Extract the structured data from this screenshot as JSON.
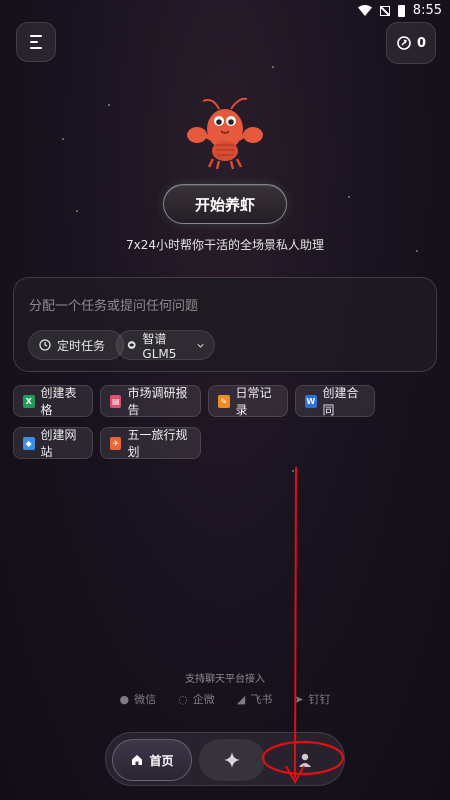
{
  "status_bar": {
    "time": "8:55"
  },
  "header": {
    "credits": "0"
  },
  "hero": {
    "start_button": "开始养虾",
    "tagline": "7x24小时帮你干活的全场景私人助理"
  },
  "composer": {
    "placeholder": "分配一个任务或提问任何问题",
    "timer_chip": "定时任务",
    "model_chip": "智谱 GLM5"
  },
  "quick_actions": [
    {
      "label": "创建表格",
      "icon": "spreadsheet-icon",
      "color": "#1f9d57"
    },
    {
      "label": "市场调研报告",
      "icon": "report-icon",
      "color": "#e04f6b"
    },
    {
      "label": "日常记录",
      "icon": "note-icon",
      "color": "#f08a24"
    },
    {
      "label": "创建合同",
      "icon": "word-doc-icon",
      "color": "#2f6fd6"
    },
    {
      "label": "创建网站",
      "icon": "website-icon",
      "color": "#3a8ee6"
    },
    {
      "label": "五一旅行规划",
      "icon": "travel-icon",
      "color": "#e8663a"
    }
  ],
  "platforms": {
    "title": "支持聊天平台接入",
    "items": [
      "微信",
      "企微",
      "飞书",
      "钉钉"
    ]
  },
  "bottom_nav": {
    "home_label": "首页"
  },
  "colors": {
    "annotation_red": "#e01010",
    "accent_glow": "#78ffd2"
  }
}
